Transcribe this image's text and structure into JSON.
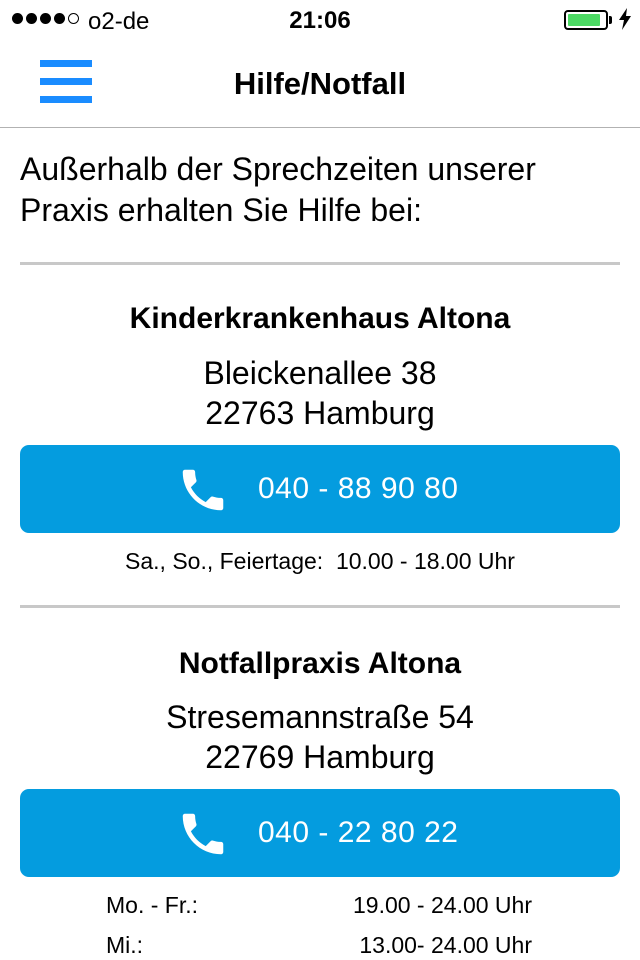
{
  "status_bar": {
    "carrier": "o2-de",
    "time": "21:06",
    "signal_bars_filled": 4,
    "signal_bars_total": 5,
    "battery_level": 0.9,
    "battery_color": "#4cd964",
    "charging_icon": "bolt-icon"
  },
  "nav": {
    "title": "Hilfe/Notfall",
    "menu_icon": "hamburger-menu-icon",
    "accent_color": "#1a8cff"
  },
  "intro": {
    "line1": "Außerhalb der Sprechzeiten unserer",
    "line2": "Praxis erhalten Sie Hilfe bei:"
  },
  "button_color": "#049cdf",
  "places": [
    {
      "name": "Kinderkrankenhaus Altona",
      "street": "Bleickenallee 38",
      "city": "22763 Hamburg",
      "phone": "040 - 88 90 80",
      "phone_icon": "phone-icon",
      "hours_text": "Sa., So., Feiertage:  10.00 - 18.00 Uhr"
    },
    {
      "name": "Notfallpraxis Altona",
      "street": "Stresemannstraße 54",
      "city": "22769 Hamburg",
      "phone": "040 - 22 80 22",
      "phone_icon": "phone-icon",
      "hours": [
        {
          "day": "Mo. - Fr.:",
          "time": "19.00 - 24.00 Uhr"
        },
        {
          "day": "Mi.:",
          "time": "13.00- 24.00 Uhr"
        }
      ]
    }
  ]
}
